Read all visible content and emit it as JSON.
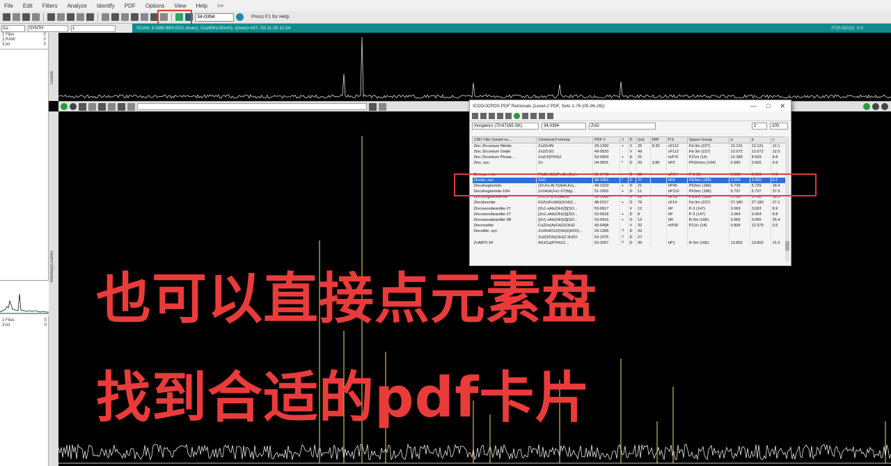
{
  "menu": [
    "File",
    "Edit",
    "Filters",
    "Analyze",
    "Identify",
    "PDF",
    "Options",
    "View",
    "Help",
    ">>"
  ],
  "toolbar": {
    "pdf_field": "34-0394",
    "hint": "Press F1 for Help"
  },
  "infobar": {
    "element_select": "Cu",
    "mode_select": "SYNTH",
    "count_value": "1",
    "scan_info": "SCAN: 5.0/89.99/0.02/1.4(sec), Cu(40kV,30mA), I(max)=167, 02-11-20 11:54",
    "right_info": "2T(0.0)C(0)",
    "right_value": "0.0"
  },
  "leftpanel": {
    "rows_top": [
      {
        "label": "2 Files",
        "value": "0"
      },
      {
        "label": "2.RAW",
        "value": "0"
      },
      {
        "label": "3.txt",
        "value": "0"
      }
    ],
    "rows_bottom": [
      {
        "label": "1 Files",
        "value": "0"
      },
      {
        "label": "3.txt",
        "value": "0"
      }
    ]
  },
  "axis_labels": {
    "top": "Counts",
    "main": "Intensity(Counts)"
  },
  "dialog": {
    "title": "ICDD/JCPDS PDF Retrievals (Level-2 PDF, Sets 1-76 (05-06-26))",
    "filter_group": "Inorganics (70-67165 GK)",
    "filter_pdf": "34-0394",
    "filter_formula": "ZnO",
    "filter_n1": "2",
    "filter_n2": "100",
    "columns": [
      "1367 Hits Sorted on...",
      "Chemical Formula",
      "PDF #",
      "J",
      "D",
      "I(ct)",
      "RIR",
      "P.S.",
      "Space Group",
      "a",
      "b",
      "c"
    ],
    "rows": [
      [
        "Zinc Zirconium Nitride",
        "Zn2Zr4N",
        "29-1390",
        "+",
        "C",
        "26",
        "8.30",
        "cF112",
        "Fd-3m (227)",
        "12.131",
        "12.131",
        "12.1"
      ],
      [
        "Zinc Zirconium Oxide",
        "Zn2Zr3O",
        "49-0033",
        "",
        "V",
        "49",
        "",
        "cF112",
        "Fd-3m (227)",
        "12.072",
        "12.072",
        "12.0"
      ],
      [
        "Zinc Zirconium Phosp...",
        "ZnZr2(PO4)3",
        "53-0959",
        "+",
        "D",
        "25",
        "",
        "mP76",
        "P21/n (14)",
        "12.389",
        "8.929",
        "8.8"
      ],
      [
        "Zinc, syn",
        "Zn",
        "04-0831",
        "*",
        "D",
        "20",
        "3.80",
        "hP2",
        "P63/mmc (194)",
        "2.665",
        "2.665",
        "4.9"
      ],
      [
        "",
        "",
        "",
        "",
        "",
        "",
        "",
        "",
        "",
        "",
        "",
        ""
      ],
      [
        "Zincogermite",
        "Pb(Zn,Cd)(Fe,Zn,Cu)...",
        "51-1443",
        "+",
        "D",
        "32",
        "",
        "aP14",
        "P-1 (2)",
        "5.593",
        "5.620",
        "7.6"
      ],
      [
        "Zincite, syn",
        "ZnO",
        "36-1451",
        "*",
        "D",
        "27",
        "",
        "hP4",
        "P63mc (186)",
        "3.250",
        "3.250",
        "5.2"
      ],
      [
        "Zincohogbomite",
        "(Zn,Fe,Al,Ti)4(Al,Fe)...",
        "49-1023",
        "+",
        "D",
        "21",
        "",
        "hP46",
        "P63mc (186)",
        "5.729",
        "5.729",
        "18.4"
      ],
      [
        "Zincohogbomite-16H",
        "Zn14(Al,Fe)~57(Mg...",
        "51-1655",
        "+",
        "D",
        "11",
        "",
        "hP110",
        "P63mc (186)",
        "5.737",
        "5.737",
        "37.0"
      ],
      [
        "Zincohogbomite-8H",
        "Zn1.57(0.25)AlO8",
        "51-1666",
        "",
        "V",
        "26",
        "",
        "hP55",
        "P63mc (186)",
        "5.708",
        "5.708",
        "18.3"
      ],
      [
        "Zincolivenite",
        "K2Zn(Fe3Al)(SO4)2...",
        "48-0157",
        "+",
        "D",
        "76",
        "",
        "cF14",
        "Fd-3m (227)",
        "27.180",
        "27.180",
        "27.1"
      ],
      [
        "Zincowoodwardite-1T",
        "[Zn1-xAlx(OH)2][(SO...",
        "53-0917",
        "",
        "V",
        "12",
        "",
        "hP",
        "P-3 (147)",
        "3.063",
        "3.063",
        "8.9"
      ],
      [
        "Zincowoodwardite-1T",
        "[Zn1-xAlx(OH)2][(SO...",
        "53-0918",
        "+",
        "D",
        "8",
        "",
        "hP",
        "P-3 (147)",
        "3.064",
        "3.064",
        "8.8"
      ],
      [
        "Zincowoodwardite-3R",
        "[Zn1-xAlx(OH)2][(SO...",
        "53-0916",
        "+",
        "D",
        "12",
        "",
        "hR",
        "R-3m (166)",
        "3.065",
        "3.065",
        "25.4"
      ],
      [
        "Zincroselite",
        "Ca2Zn(AsO4)2(OH)2",
        "40-0498",
        "",
        "V",
        "32",
        "",
        "mP30",
        "P21/c (14)",
        "5.834",
        "12.975",
        "5.6"
      ],
      [
        "Zincsilite, syn",
        "Zn3Si4O10(OH)2(H2O)...",
        "29-1395",
        "?",
        "D",
        "20",
        "",
        "",
        "",
        "",
        "",
        ""
      ],
      [
        "",
        "Zn2(SO4)(OH)2·2H2O",
        "53-1075",
        "?",
        "D",
        "27",
        "",
        "",
        "",
        "",
        "",
        ""
      ],
      [
        "ZnAlPO-34",
        "Al11Ca(PO4)12...",
        "53-1607",
        "?",
        "D",
        "36",
        "",
        "hP1",
        "R-3m (166)",
        "13.802",
        "13.802",
        "15.3"
      ]
    ]
  },
  "caption": {
    "line1": "也可以直接点元素盘",
    "line2": "找到合适的pdf卡片"
  },
  "colors": {
    "highlight_red": "#e23a3a",
    "caption_red": "#ea3b3b",
    "teal_bar": "#0f8a8a",
    "selected_row": "#2f6fd6"
  }
}
